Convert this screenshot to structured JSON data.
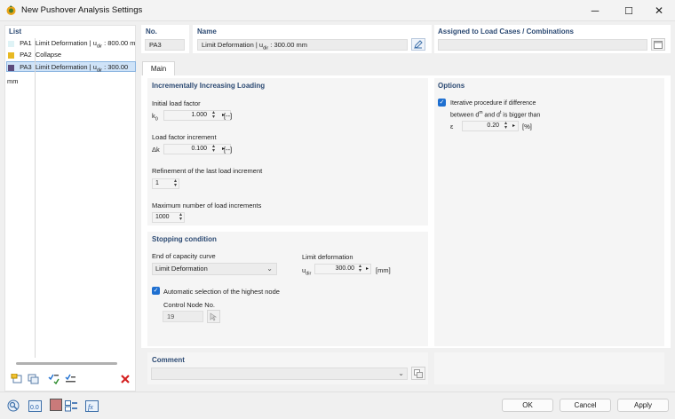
{
  "window": {
    "title": "New Pushover Analysis Settings",
    "minimize": "─",
    "maximize": "☐",
    "close": "✕"
  },
  "list": {
    "header": "List",
    "items": [
      {
        "code": "PA1",
        "label": "Limit Deformation | u",
        "sub": "dir",
        "tail": " : 800.00 m",
        "color": "#dff3f6"
      },
      {
        "code": "PA2",
        "label": "Collapse",
        "sub": "",
        "tail": "",
        "color": "#e8b923"
      },
      {
        "code": "PA3",
        "label": "Limit Deformation | u",
        "sub": "dir",
        "tail": " : 300.00 mm",
        "color": "#5a4a7c"
      }
    ]
  },
  "header": {
    "no_label": "No.",
    "no_value": "PA3",
    "name_label": "Name",
    "name_value": "Limit Deformation | u",
    "name_sub": "dir",
    "name_tail": " : 300.00 mm",
    "assigned_label": "Assigned to Load Cases / Combinations"
  },
  "tabs": [
    {
      "label": "Main"
    }
  ],
  "loading": {
    "title": "Incrementally Increasing Loading",
    "initial_label": "Initial load factor",
    "initial_sym": "k",
    "initial_sub": "0",
    "initial_value": "1.000",
    "initial_unit": "[--]",
    "increment_label": "Load factor increment",
    "increment_sym": "Δk",
    "increment_value": "0.100",
    "increment_unit": "[--]",
    "refinement_label": "Refinement of the last load increment",
    "refinement_value": "1",
    "max_label": "Maximum number of load increments",
    "max_value": "1000"
  },
  "options": {
    "title": "Options",
    "iter_line1": "Iterative procedure if difference",
    "iter_line2a": "between d",
    "iter_sup1": "m",
    "iter_line2b": " and d",
    "iter_sup2": "t",
    "iter_line2c": " is bigger than",
    "eps_sym": "ε",
    "eps_value": "0.20",
    "eps_unit": "[%]"
  },
  "stopping": {
    "title": "Stopping condition",
    "end_label": "End of capacity curve",
    "end_value": "Limit Deformation",
    "limit_label": "Limit deformation",
    "limit_sym": "u",
    "limit_sub": "dir",
    "limit_value": "300.00",
    "limit_unit": "[mm]",
    "auto_label": "Automatic selection of the highest node",
    "control_label": "Control Node No.",
    "control_value": "19"
  },
  "comment": {
    "title": "Comment"
  },
  "buttons": {
    "ok": "OK",
    "cancel": "Cancel",
    "apply": "Apply"
  }
}
